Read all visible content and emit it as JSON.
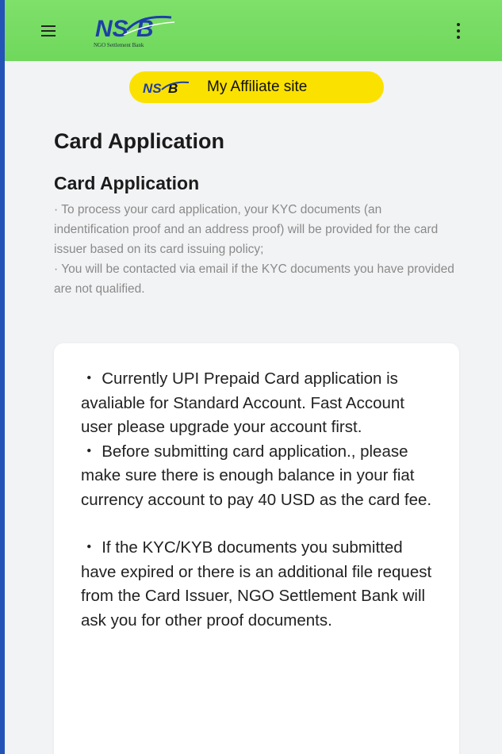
{
  "header": {
    "logo_text": "NSB",
    "logo_subtitle": "NGO Settlement Bank",
    "menu_icon": "hamburger-menu-icon",
    "more_icon": "more-vertical-icon"
  },
  "affiliate": {
    "label": "My Affiliate site"
  },
  "page": {
    "title": "Card Application",
    "section_title": "Card Application",
    "notes": [
      "· To process your card application, your KYC documents (an indentification proof and an address proof) will be provided for the card issuer based on its card issuing policy;",
      "· You will be contacted via email if the KYC documents you have provided are not qualified."
    ]
  },
  "card": {
    "items": [
      "・ Currently UPI Prepaid Card application is avaliable for Standard Account. Fast Account user please upgrade your account first.",
      "・ Before submitting card application., please make sure there is enough balance in your fiat currency account to pay 40 USD as the card fee.",
      "・ If the KYC/KYB documents you submitted have expired or there is an additional file request from the Card Issuer, NGO Settlement Bank will ask you for other proof documents."
    ]
  },
  "colors": {
    "topbar": "#6fd85c",
    "affiliate_button": "#fbe100",
    "logo_blue": "#1d3fa8",
    "background": "#2453b8"
  }
}
